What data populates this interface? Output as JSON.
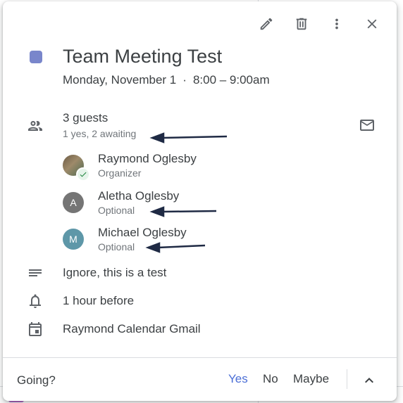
{
  "toolbar": {
    "edit_icon": "pencil-icon",
    "delete_icon": "trash-icon",
    "more_icon": "more-vert-icon",
    "close_icon": "close-icon"
  },
  "event": {
    "color": "#7986cb",
    "title": "Team Meeting Test",
    "date": "Monday, November 1",
    "separator": "·",
    "time": "8:00 – 9:00am"
  },
  "guests": {
    "summary": "3 guests",
    "status": "1 yes, 2 awaiting",
    "list": [
      {
        "name": "Raymond Oglesby",
        "role": "Organizer",
        "initial": "",
        "accepted": true
      },
      {
        "name": "Aletha Oglesby",
        "role": "Optional",
        "initial": "A",
        "accepted": false
      },
      {
        "name": "Michael Oglesby",
        "role": "Optional",
        "initial": "M",
        "accepted": false
      }
    ]
  },
  "description": "Ignore, this is a test",
  "reminder": "1 hour before",
  "calendar": "Raymond Calendar Gmail",
  "footer": {
    "prompt": "Going?",
    "yes": "Yes",
    "no": "No",
    "maybe": "Maybe",
    "accent_color": "#4c6fd6"
  }
}
